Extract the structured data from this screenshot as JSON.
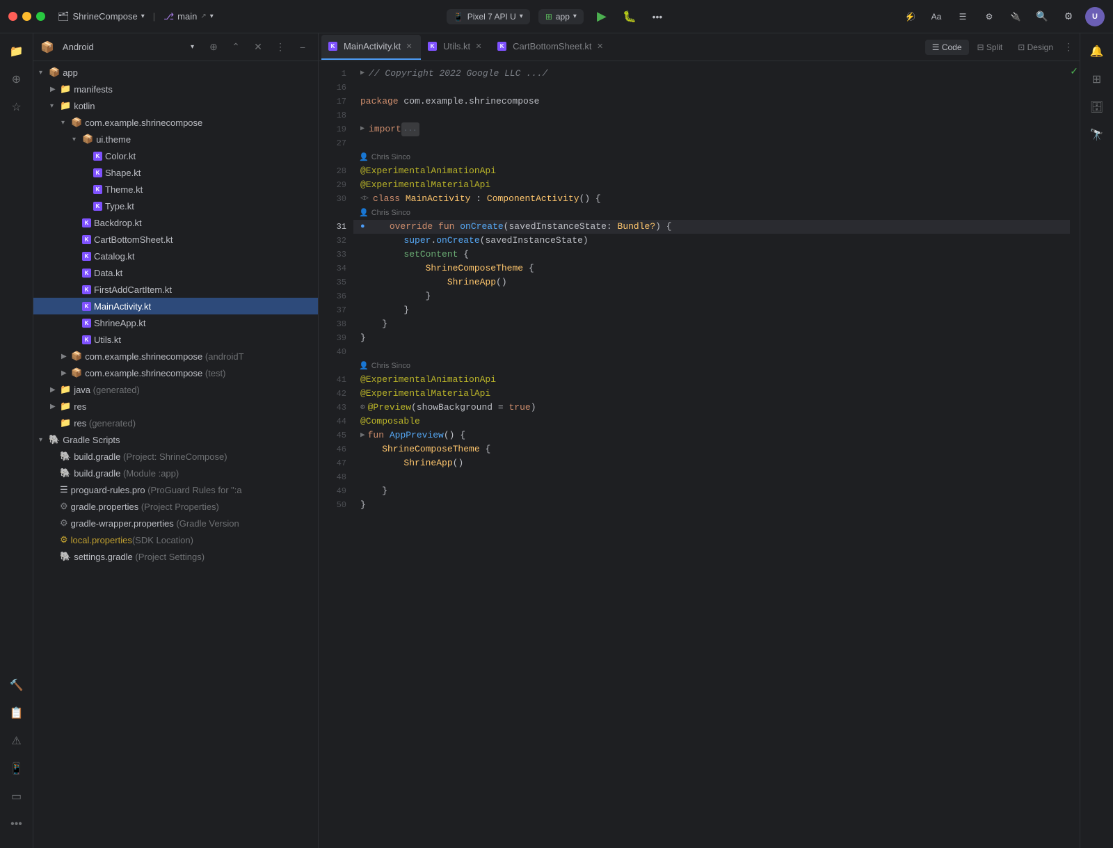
{
  "titleBar": {
    "projectName": "ShrineCompose",
    "branch": "main",
    "deviceLabel": "Pixel 7 API U",
    "appLabel": "app",
    "moreLabel": "•••"
  },
  "tabs": [
    {
      "label": "MainActivity.kt",
      "active": true,
      "closeable": true
    },
    {
      "label": "Utils.kt",
      "active": false,
      "closeable": true
    },
    {
      "label": "CartBottomSheet.kt",
      "active": false,
      "closeable": true
    }
  ],
  "viewModes": [
    {
      "label": "Code",
      "active": true
    },
    {
      "label": "Split",
      "active": false
    },
    {
      "label": "Design",
      "active": false
    }
  ],
  "fileTree": {
    "header": "Android",
    "items": [
      {
        "id": "app",
        "label": "app",
        "indent": 0,
        "type": "folder",
        "expanded": true
      },
      {
        "id": "manifests",
        "label": "manifests",
        "indent": 1,
        "type": "folder",
        "expanded": false
      },
      {
        "id": "kotlin",
        "label": "kotlin",
        "indent": 1,
        "type": "folder",
        "expanded": true
      },
      {
        "id": "com.example.shrinecompose",
        "label": "com.example.shrinecompose",
        "indent": 2,
        "type": "package",
        "expanded": true
      },
      {
        "id": "ui.theme",
        "label": "ui.theme",
        "indent": 3,
        "type": "package",
        "expanded": true
      },
      {
        "id": "Color.kt",
        "label": "Color.kt",
        "indent": 4,
        "type": "kt"
      },
      {
        "id": "Shape.kt",
        "label": "Shape.kt",
        "indent": 4,
        "type": "kt"
      },
      {
        "id": "Theme.kt",
        "label": "Theme.kt",
        "indent": 4,
        "type": "kt"
      },
      {
        "id": "Type.kt",
        "label": "Type.kt",
        "indent": 4,
        "type": "kt"
      },
      {
        "id": "Backdrop.kt",
        "label": "Backdrop.kt",
        "indent": 3,
        "type": "kt"
      },
      {
        "id": "CartBottomSheet.kt",
        "label": "CartBottomSheet.kt",
        "indent": 3,
        "type": "kt"
      },
      {
        "id": "Catalog.kt",
        "label": "Catalog.kt",
        "indent": 3,
        "type": "kt"
      },
      {
        "id": "Data.kt",
        "label": "Data.kt",
        "indent": 3,
        "type": "kt"
      },
      {
        "id": "FirstAddCartItem.kt",
        "label": "FirstAddCartItem.kt",
        "indent": 3,
        "type": "kt"
      },
      {
        "id": "MainActivity.kt",
        "label": "MainActivity.kt",
        "indent": 3,
        "type": "kt",
        "selected": true
      },
      {
        "id": "ShrineApp.kt",
        "label": "ShrineApp.kt",
        "indent": 3,
        "type": "kt"
      },
      {
        "id": "Utils.kt",
        "label": "Utils.kt",
        "indent": 3,
        "type": "kt"
      },
      {
        "id": "com.example.shrinecompose.androidT",
        "label": "com.example.shrinecompose (androidT",
        "indent": 2,
        "type": "package-collapsed"
      },
      {
        "id": "com.example.shrinecompose.test",
        "label": "com.example.shrinecompose (test)",
        "indent": 2,
        "type": "package-collapsed"
      },
      {
        "id": "java",
        "label": "java (generated)",
        "indent": 1,
        "type": "folder-collapsed"
      },
      {
        "id": "res",
        "label": "res",
        "indent": 1,
        "type": "folder-collapsed"
      },
      {
        "id": "res-generated",
        "label": "res (generated)",
        "indent": 1,
        "type": "folder-nochevron"
      },
      {
        "id": "gradle-scripts",
        "label": "Gradle Scripts",
        "indent": 0,
        "type": "gradle-folder",
        "expanded": true
      },
      {
        "id": "build.gradle.project",
        "label": "build.gradle",
        "sublabel": "(Project: ShrineCompose)",
        "indent": 1,
        "type": "gradle"
      },
      {
        "id": "build.gradle.module",
        "label": "build.gradle",
        "sublabel": "(Module :app)",
        "indent": 1,
        "type": "gradle"
      },
      {
        "id": "proguard-rules.pro",
        "label": "proguard-rules.pro",
        "sublabel": "(ProGuard Rules for \":a",
        "indent": 1,
        "type": "proguard"
      },
      {
        "id": "gradle.properties",
        "label": "gradle.properties",
        "sublabel": "(Project Properties)",
        "indent": 1,
        "type": "properties"
      },
      {
        "id": "gradle-wrapper.properties",
        "label": "gradle-wrapper.properties",
        "sublabel": "(Gradle Version",
        "indent": 1,
        "type": "properties"
      },
      {
        "id": "local.properties",
        "label": "local.properties",
        "sublabel": "(SDK Location)",
        "indent": 1,
        "type": "properties-local"
      },
      {
        "id": "settings.gradle",
        "label": "settings.gradle",
        "sublabel": "(Project Settings)",
        "indent": 1,
        "type": "gradle"
      }
    ]
  },
  "codeLines": [
    {
      "num": 1,
      "type": "code"
    },
    {
      "num": 16,
      "type": "blank"
    },
    {
      "num": 17,
      "type": "code"
    },
    {
      "num": 18,
      "type": "blank"
    },
    {
      "num": 19,
      "type": "code"
    },
    {
      "num": 27,
      "type": "blank"
    },
    {
      "num": 27.5,
      "type": "git-author",
      "author": "Chris Sinco"
    },
    {
      "num": 28,
      "type": "code"
    },
    {
      "num": 29,
      "type": "code"
    },
    {
      "num": 30,
      "type": "code"
    },
    {
      "num": 30.5,
      "type": "git-author",
      "author": "Chris Sinco"
    },
    {
      "num": 31,
      "type": "code",
      "highlighted": true
    },
    {
      "num": 32,
      "type": "code"
    },
    {
      "num": 33,
      "type": "code"
    },
    {
      "num": 34,
      "type": "code"
    },
    {
      "num": 35,
      "type": "code"
    },
    {
      "num": 36,
      "type": "code"
    },
    {
      "num": 37,
      "type": "code"
    },
    {
      "num": 38,
      "type": "code"
    },
    {
      "num": 39,
      "type": "code"
    },
    {
      "num": 40,
      "type": "blank"
    },
    {
      "num": 40.5,
      "type": "git-author",
      "author": "Chris Sinco"
    },
    {
      "num": 41,
      "type": "code"
    },
    {
      "num": 42,
      "type": "code"
    },
    {
      "num": 43,
      "type": "code"
    },
    {
      "num": 44,
      "type": "code"
    },
    {
      "num": 45,
      "type": "code"
    },
    {
      "num": 46,
      "type": "code"
    },
    {
      "num": 47,
      "type": "code"
    },
    {
      "num": 48,
      "type": "blank"
    },
    {
      "num": 49,
      "type": "code"
    },
    {
      "num": 50,
      "type": "code"
    }
  ],
  "iconBar": {
    "items": [
      "📁",
      "🔍",
      "⚡",
      "🔃",
      "⚠️",
      "🔮",
      "📱"
    ]
  }
}
